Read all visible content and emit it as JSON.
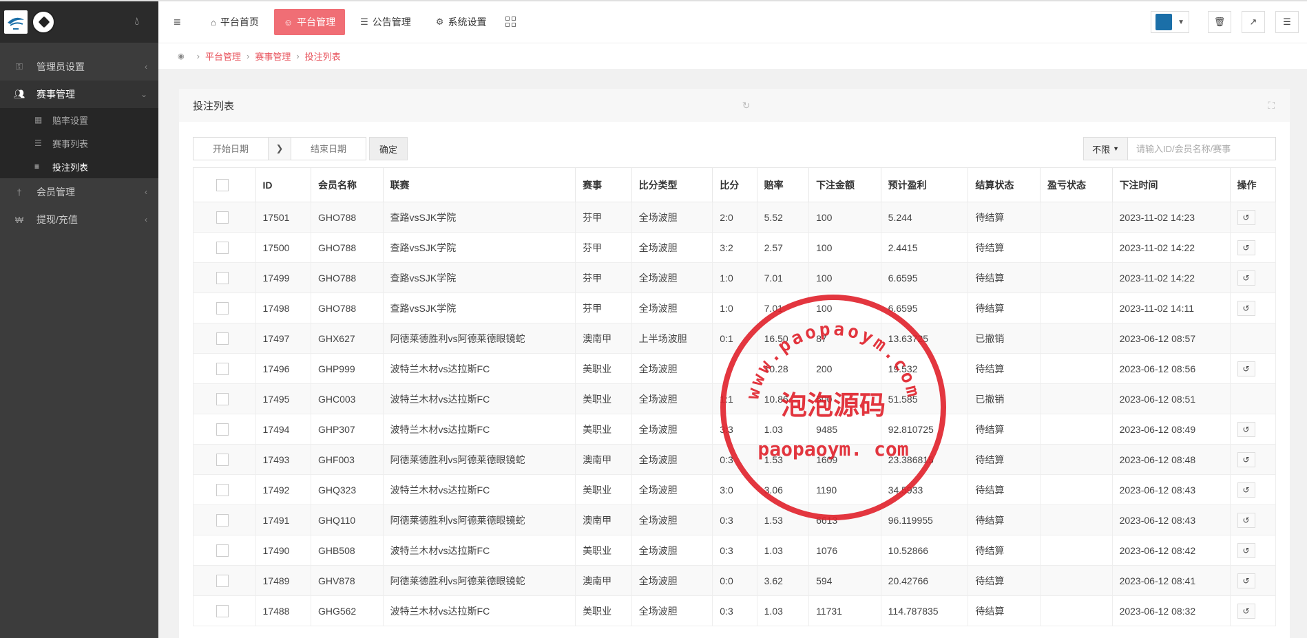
{
  "sidebar": {
    "items": [
      {
        "label": "管理员设置"
      },
      {
        "label": "赛事管理"
      },
      {
        "label": "会员管理"
      },
      {
        "label": "提现/充值"
      }
    ],
    "sub": [
      {
        "label": "赔率设置"
      },
      {
        "label": "赛事列表"
      },
      {
        "label": "投注列表"
      }
    ]
  },
  "topnav": {
    "tabs": [
      {
        "label": "平台首页"
      },
      {
        "label": "平台管理"
      },
      {
        "label": "公告管理"
      },
      {
        "label": "系统设置"
      }
    ]
  },
  "breadcrumb": [
    "平台管理",
    "赛事管理",
    "投注列表"
  ],
  "panel": {
    "title": "投注列表",
    "start_placeholder": "开始日期",
    "end_placeholder": "结束日期",
    "confirm_label": "确定",
    "select_label": "不限",
    "search_placeholder": "请输入ID/会员名称/赛事"
  },
  "table": {
    "headers": [
      "ID",
      "会员名称",
      "联赛",
      "赛事",
      "比分类型",
      "比分",
      "赔率",
      "下注金额",
      "预计盈利",
      "结算状态",
      "盈亏状态",
      "下注时间",
      "操作"
    ],
    "rows": [
      [
        "17501",
        "GHO788",
        "查路vsSJK学院",
        "芬甲",
        "全场波胆",
        "2:0",
        "5.52",
        "100",
        "5.244",
        "待结算",
        "",
        "2023-11-02 14:23"
      ],
      [
        "17500",
        "GHO788",
        "查路vsSJK学院",
        "芬甲",
        "全场波胆",
        "3:2",
        "2.57",
        "100",
        "2.4415",
        "待结算",
        "",
        "2023-11-02 14:22"
      ],
      [
        "17499",
        "GHO788",
        "查路vsSJK学院",
        "芬甲",
        "全场波胆",
        "1:0",
        "7.01",
        "100",
        "6.6595",
        "待结算",
        "",
        "2023-11-02 14:22"
      ],
      [
        "17498",
        "GHO788",
        "查路vsSJK学院",
        "芬甲",
        "全场波胆",
        "1:0",
        "7.01",
        "100",
        "6.6595",
        "待结算",
        "",
        "2023-11-02 14:11"
      ],
      [
        "17497",
        "GHX627",
        "阿德莱德胜利vs阿德莱德眼镜蛇",
        "澳南甲",
        "上半场波胆",
        "0:1",
        "16.50",
        "87",
        "13.63725",
        "已撤销",
        "",
        "2023-06-12 08:57"
      ],
      [
        "17496",
        "GHP999",
        "波特兰木材vs达拉斯FC",
        "美职业",
        "全场波胆",
        "",
        "10.28",
        "200",
        "19.532",
        "待结算",
        "",
        "2023-06-12 08:56"
      ],
      [
        "17495",
        "GHC003",
        "波特兰木材vs达拉斯FC",
        "美职业",
        "全场波胆",
        "1:1",
        "10.86",
        "500",
        "51.585",
        "已撤销",
        "",
        "2023-06-12 08:51"
      ],
      [
        "17494",
        "GHP307",
        "波特兰木材vs达拉斯FC",
        "美职业",
        "全场波胆",
        "3:3",
        "1.03",
        "9485",
        "92.810725",
        "待结算",
        "",
        "2023-06-12 08:49"
      ],
      [
        "17493",
        "GHF003",
        "阿德莱德胜利vs阿德莱德眼镜蛇",
        "澳南甲",
        "全场波胆",
        "0:3",
        "1.53",
        "1609",
        "23.386815",
        "待结算",
        "",
        "2023-06-12 08:48"
      ],
      [
        "17492",
        "GHQ323",
        "波特兰木材vs达拉斯FC",
        "美职业",
        "全场波胆",
        "3:0",
        "3.06",
        "1190",
        "34.5933",
        "待结算",
        "",
        "2023-06-12 08:43"
      ],
      [
        "17491",
        "GHQ110",
        "阿德莱德胜利vs阿德莱德眼镜蛇",
        "澳南甲",
        "全场波胆",
        "0:3",
        "1.53",
        "6613",
        "96.119955",
        "待结算",
        "",
        "2023-06-12 08:43"
      ],
      [
        "17490",
        "GHB508",
        "波特兰木材vs达拉斯FC",
        "美职业",
        "全场波胆",
        "0:3",
        "1.03",
        "1076",
        "10.52866",
        "待结算",
        "",
        "2023-06-12 08:42"
      ],
      [
        "17489",
        "GHV878",
        "阿德莱德胜利vs阿德莱德眼镜蛇",
        "澳南甲",
        "全场波胆",
        "0:0",
        "3.62",
        "594",
        "20.42766",
        "待结算",
        "",
        "2023-06-12 08:41"
      ],
      [
        "17488",
        "GHG562",
        "波特兰木材vs达拉斯FC",
        "美职业",
        "全场波胆",
        "0:3",
        "1.03",
        "11731",
        "114.787835",
        "待结算",
        "",
        "2023-06-12 08:32"
      ]
    ],
    "op_rows": [
      true,
      true,
      true,
      true,
      false,
      true,
      false,
      true,
      true,
      true,
      true,
      true,
      true,
      true
    ]
  },
  "stamp": {
    "arc_text": "www.paopaoym.com",
    "center_text": "泡泡源码",
    "bottom_text": "paopaoym. com",
    "color": "#e0202a"
  },
  "colors": {
    "accent": "#f06e75",
    "sidebar": "#3c3c3c",
    "link": "#e8545d"
  }
}
